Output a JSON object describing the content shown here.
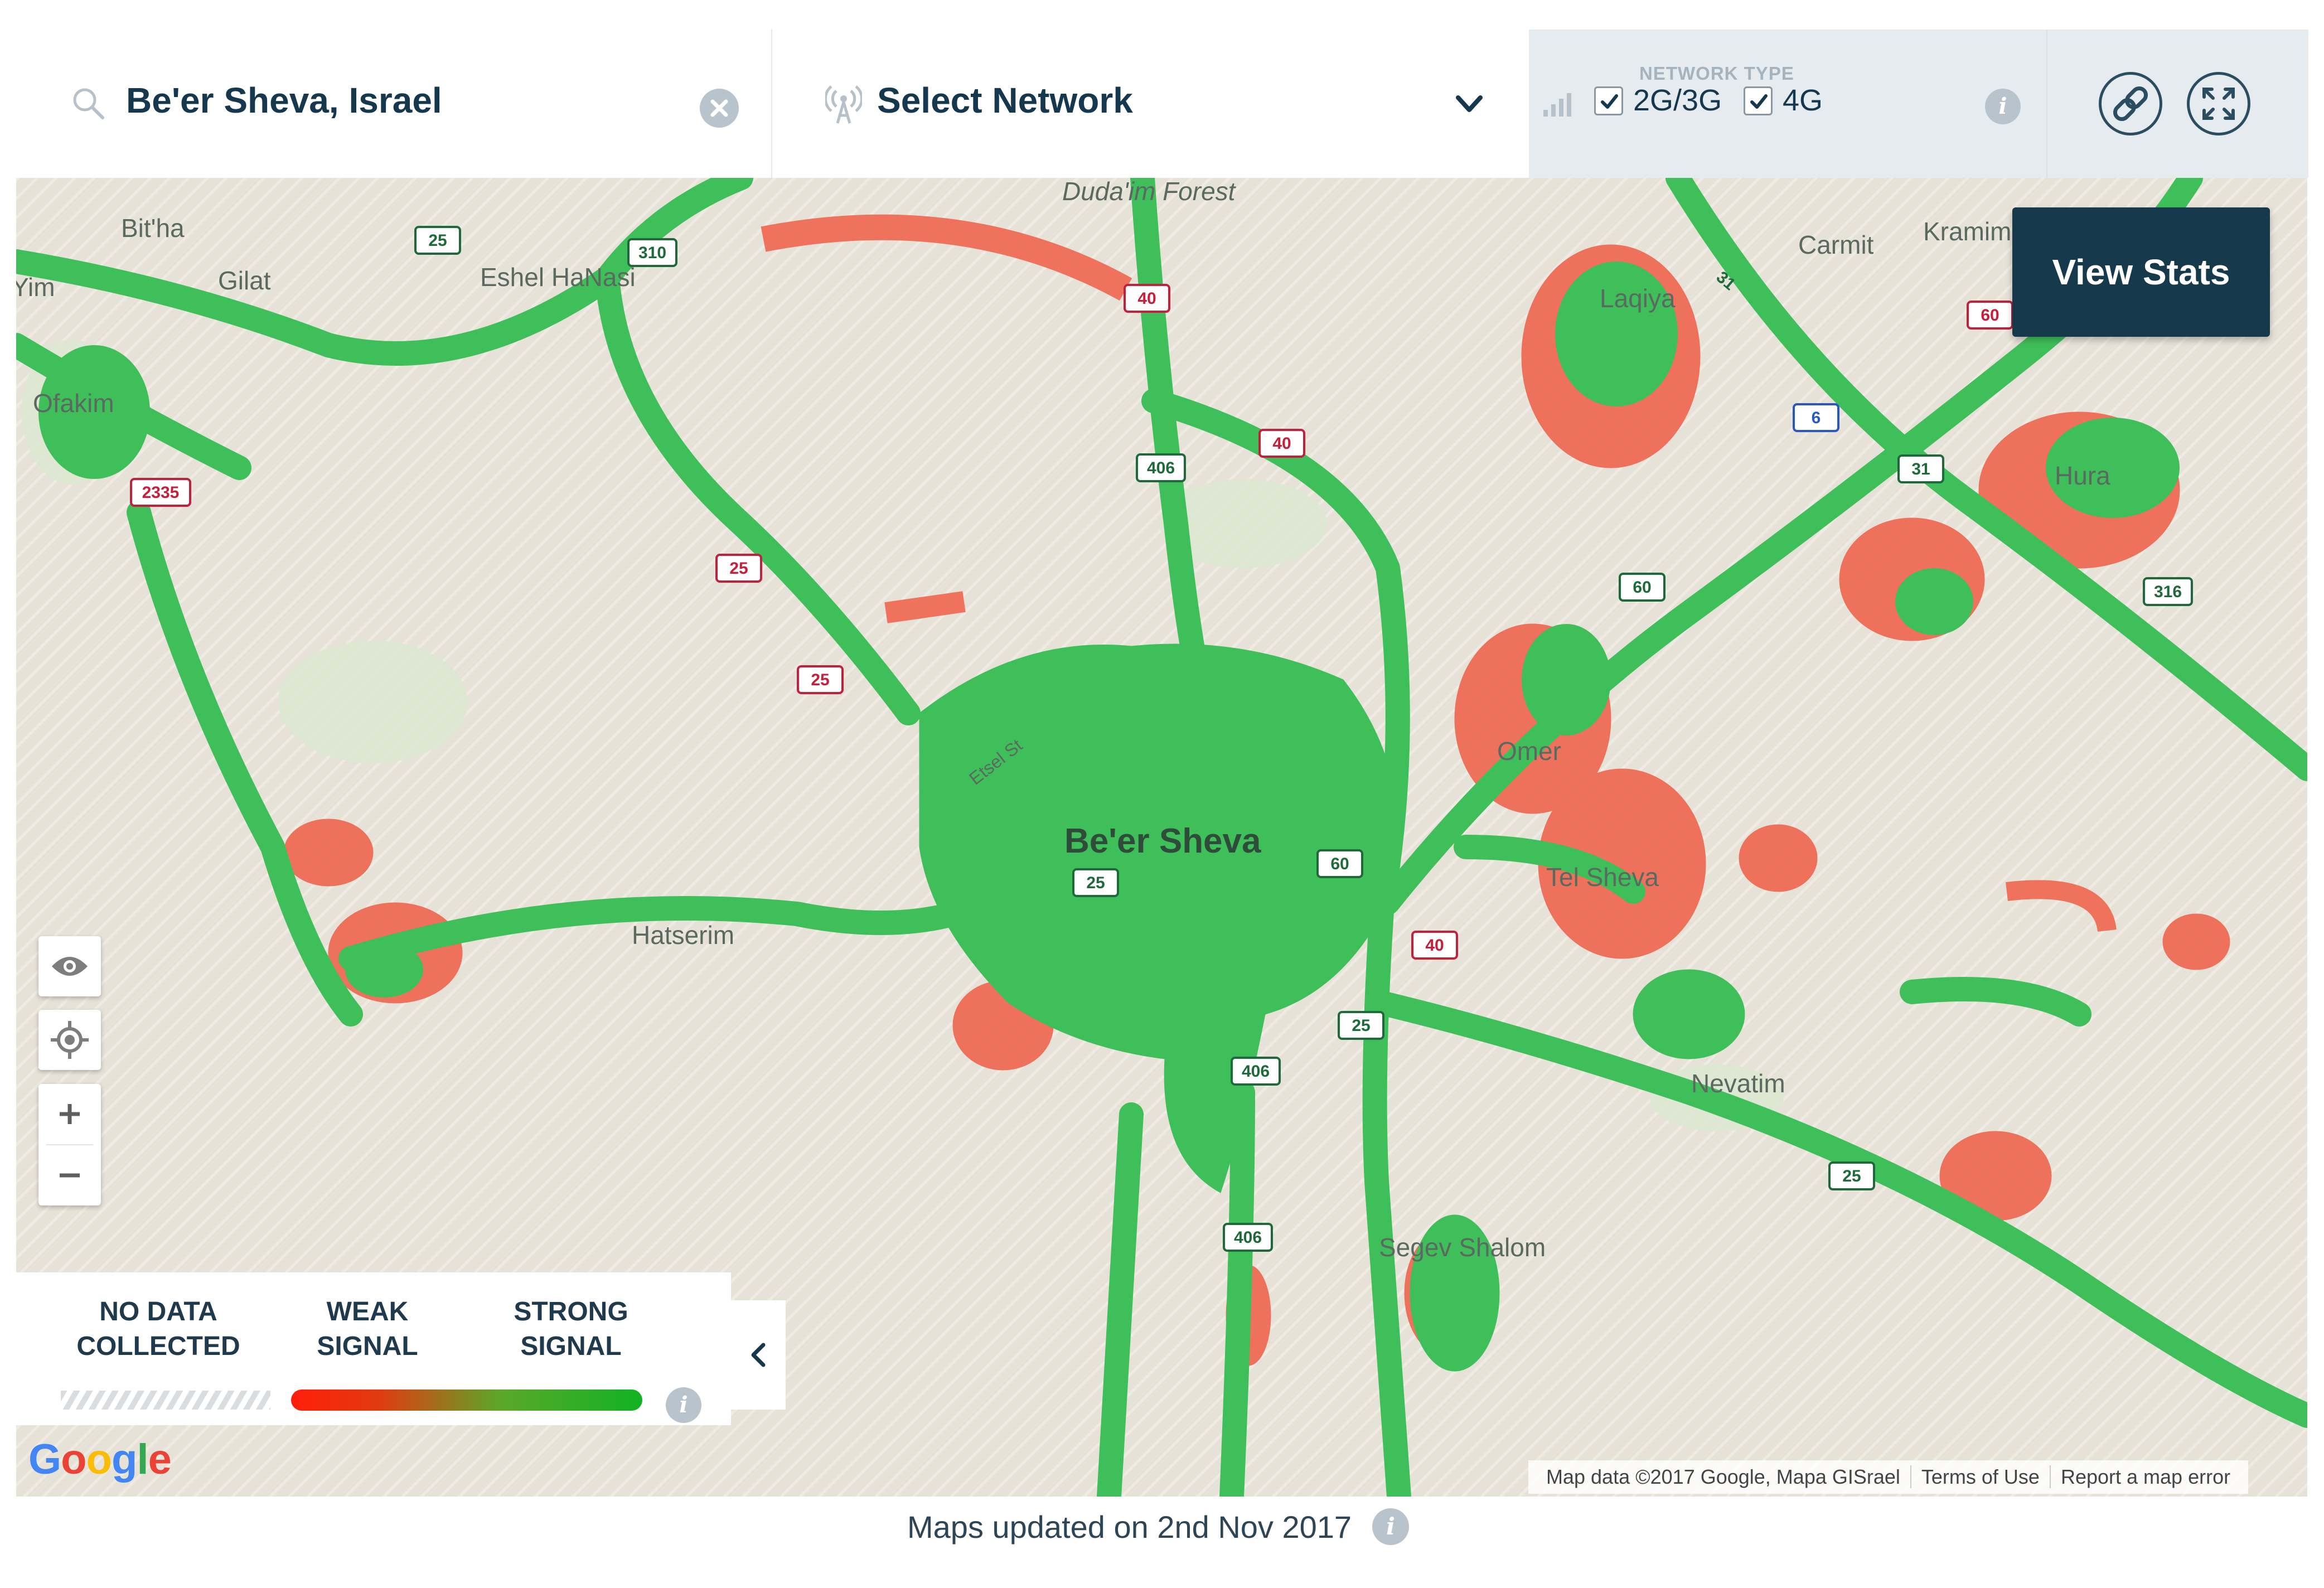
{
  "search": {
    "query": "Be'er Sheva, Israel"
  },
  "network": {
    "label": "Select Network"
  },
  "network_type": {
    "title": "NETWORK TYPE",
    "options": [
      {
        "label": "2G/3G",
        "checked": true
      },
      {
        "label": "4G",
        "checked": true
      }
    ]
  },
  "map": {
    "view_stats": "View Stats",
    "places": {
      "bitha": "Bit'ha",
      "gilat": "Gilat",
      "yim": "Yim",
      "eshel": "Eshel HaNasi",
      "ofakim": "Ofakim",
      "dudaim": "Duda'im Forest",
      "laqiya": "Laqiya",
      "carmit": "Carmit",
      "kramim": "Kramim",
      "hura": "Hura",
      "beer_sheva": "Be'er Sheva",
      "omer": "Omer",
      "tel_sheva": "Tel Sheva",
      "hatserim": "Hatserim",
      "nevatim": "Nevatim",
      "segev_shalom": "Segev Shalom",
      "esel_st": "Etsel St"
    },
    "shields": {
      "r25a": "25",
      "r310": "310",
      "r40a": "40",
      "r2335": "2335",
      "r25b": "25",
      "r25c": "25",
      "r406a": "406",
      "r40b": "40",
      "r60a": "60",
      "r6": "6",
      "r31": "31",
      "r31b": "31",
      "r60b": "60",
      "r316": "316",
      "r25d": "25",
      "r60c": "60",
      "r40c": "40",
      "r25e": "25",
      "r406b": "406",
      "r406c": "406",
      "r25f": "25"
    }
  },
  "legend": {
    "no_data": [
      "NO DATA",
      "COLLECTED"
    ],
    "weak": [
      "WEAK",
      "SIGNAL"
    ],
    "strong": [
      "STRONG",
      "SIGNAL"
    ]
  },
  "attribution": {
    "map_data": "Map data ©2017 Google, Mapa GISrael",
    "terms": "Terms of Use",
    "report": "Report a map error"
  },
  "google_logo": "Google",
  "footer": {
    "updated": "Maps updated on 2nd Nov 2017"
  },
  "colors": {
    "strong": "#3fbf5a",
    "weak": "#ef6b55",
    "nodata_bg": "#e7e2d8",
    "accent_dark": "#17394c"
  },
  "icons": {
    "search": "search-icon",
    "clear": "clear-icon",
    "antenna": "antenna-icon",
    "chevron": "chevron-down-icon",
    "signal": "signal-bars-icon",
    "info": "info-icon",
    "link": "link-icon",
    "fullscreen": "fullscreen-icon",
    "eye": "eye-icon",
    "locate": "locate-icon",
    "zoom_in": "plus-icon",
    "zoom_out": "minus-icon",
    "collapse": "chevron-left-icon"
  }
}
